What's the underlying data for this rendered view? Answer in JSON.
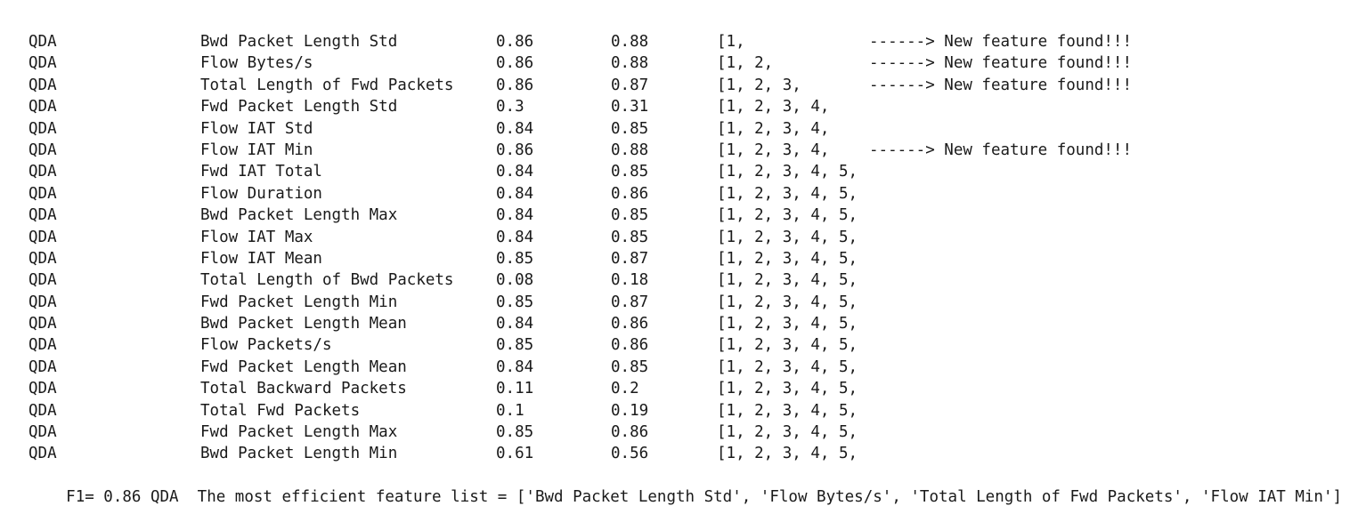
{
  "rows": [
    {
      "model": "QDA",
      "feature": "Bwd Packet Length Std",
      "score1": "0.86",
      "score2": "0.88",
      "list": "[1,",
      "note": "------> New feature found!!!"
    },
    {
      "model": "QDA",
      "feature": "Flow Bytes/s",
      "score1": "0.86",
      "score2": "0.88",
      "list": "[1, 2,",
      "note": "------> New feature found!!!"
    },
    {
      "model": "QDA",
      "feature": "Total Length of Fwd Packets",
      "score1": "0.86",
      "score2": "0.87",
      "list": "[1, 2, 3,",
      "note": "------> New feature found!!!"
    },
    {
      "model": "QDA",
      "feature": "Fwd Packet Length Std",
      "score1": "0.3",
      "score2": "0.31",
      "list": "[1, 2, 3, 4,",
      "note": ""
    },
    {
      "model": "QDA",
      "feature": "Flow IAT Std",
      "score1": "0.84",
      "score2": "0.85",
      "list": "[1, 2, 3, 4,",
      "note": ""
    },
    {
      "model": "QDA",
      "feature": "Flow IAT Min",
      "score1": "0.86",
      "score2": "0.88",
      "list": "[1, 2, 3, 4,",
      "note": "------> New feature found!!!"
    },
    {
      "model": "QDA",
      "feature": "Fwd IAT Total",
      "score1": "0.84",
      "score2": "0.85",
      "list": "[1, 2, 3, 4, 5,",
      "note": ""
    },
    {
      "model": "QDA",
      "feature": "Flow Duration",
      "score1": "0.84",
      "score2": "0.86",
      "list": "[1, 2, 3, 4, 5,",
      "note": ""
    },
    {
      "model": "QDA",
      "feature": "Bwd Packet Length Max",
      "score1": "0.84",
      "score2": "0.85",
      "list": "[1, 2, 3, 4, 5,",
      "note": ""
    },
    {
      "model": "QDA",
      "feature": "Flow IAT Max",
      "score1": "0.84",
      "score2": "0.85",
      "list": "[1, 2, 3, 4, 5,",
      "note": ""
    },
    {
      "model": "QDA",
      "feature": "Flow IAT Mean",
      "score1": "0.85",
      "score2": "0.87",
      "list": "[1, 2, 3, 4, 5,",
      "note": ""
    },
    {
      "model": "QDA",
      "feature": "Total Length of Bwd Packets",
      "score1": "0.08",
      "score2": "0.18",
      "list": "[1, 2, 3, 4, 5,",
      "note": ""
    },
    {
      "model": "QDA",
      "feature": "Fwd Packet Length Min",
      "score1": "0.85",
      "score2": "0.87",
      "list": "[1, 2, 3, 4, 5,",
      "note": ""
    },
    {
      "model": "QDA",
      "feature": "Bwd Packet Length Mean",
      "score1": "0.84",
      "score2": "0.86",
      "list": "[1, 2, 3, 4, 5,",
      "note": ""
    },
    {
      "model": "QDA",
      "feature": "Flow Packets/s",
      "score1": "0.85",
      "score2": "0.86",
      "list": "[1, 2, 3, 4, 5,",
      "note": ""
    },
    {
      "model": "QDA",
      "feature": "Fwd Packet Length Mean",
      "score1": "0.84",
      "score2": "0.85",
      "list": "[1, 2, 3, 4, 5,",
      "note": ""
    },
    {
      "model": "QDA",
      "feature": "Total Backward Packets",
      "score1": "0.11",
      "score2": "0.2",
      "list": "[1, 2, 3, 4, 5,",
      "note": ""
    },
    {
      "model": "QDA",
      "feature": "Total Fwd Packets",
      "score1": "0.1",
      "score2": "0.19",
      "list": "[1, 2, 3, 4, 5,",
      "note": ""
    },
    {
      "model": "QDA",
      "feature": "Fwd Packet Length Max",
      "score1": "0.85",
      "score2": "0.86",
      "list": "[1, 2, 3, 4, 5,",
      "note": ""
    },
    {
      "model": "QDA",
      "feature": "Bwd Packet Length Min",
      "score1": "0.61",
      "score2": "0.56",
      "list": "[1, 2, 3, 4, 5,",
      "note": ""
    }
  ],
  "summary": "F1= 0.86 QDA  The most efficient feature list = ['Bwd Packet Length Std', 'Flow Bytes/s', 'Total Length of Fwd Packets', 'Flow IAT Min']"
}
